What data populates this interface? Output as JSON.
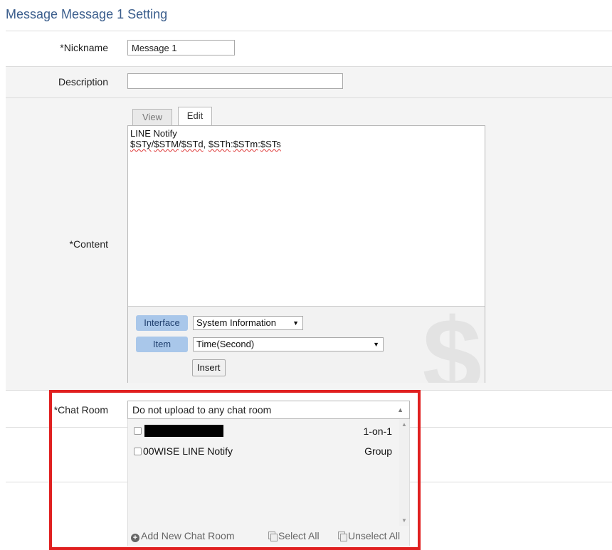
{
  "page_title": "Message Message 1 Setting",
  "fields": {
    "nickname": {
      "label": "*Nickname",
      "value": "Message 1"
    },
    "description": {
      "label": "Description",
      "value": ""
    },
    "content": {
      "label": "*Content",
      "tabs": [
        {
          "label": "View",
          "active": false
        },
        {
          "label": "Edit",
          "active": true
        }
      ],
      "lines": {
        "line1": "LINE Notify",
        "vars": [
          "$STy",
          "/",
          "$STM",
          "/",
          "$STd",
          ", ",
          "$STh",
          ":",
          "$STm",
          ":",
          "$STs"
        ]
      },
      "insert": {
        "interface_label": "Interface",
        "interface_value": "System Information",
        "item_label": "Item",
        "item_value": "Time(Second)",
        "insert_button": "Insert",
        "watermark_icon": "dollar-icon"
      }
    },
    "chat_room": {
      "label": "*Chat Room",
      "selected": "Do not upload to any chat room",
      "rooms": [
        {
          "name": "",
          "type": "1-on-1",
          "redacted": true
        },
        {
          "name": "00WISE LINE Notify",
          "type": "Group",
          "redacted": false
        }
      ],
      "footer": {
        "add": "Add New Chat Room",
        "select_all": "Select All",
        "unselect_all": "Unselect All"
      }
    }
  },
  "colors": {
    "title": "#3a5d8c",
    "pill_bg": "#a9c7ea",
    "highlight_box": "#e02020"
  }
}
